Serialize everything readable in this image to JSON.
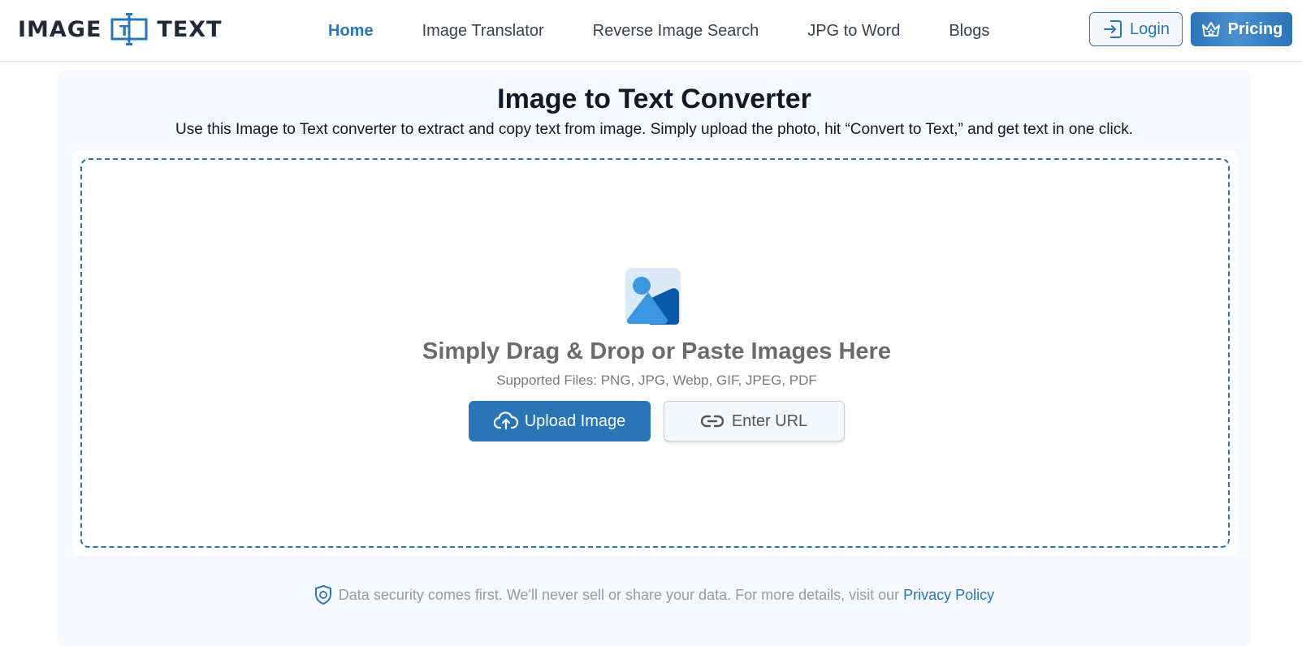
{
  "header": {
    "logo": {
      "left": "IMAGE",
      "mark": "T",
      "right": "TEXT"
    },
    "nav": [
      {
        "label": "Home",
        "active": true
      },
      {
        "label": "Image Translator",
        "active": false
      },
      {
        "label": "Reverse Image Search",
        "active": false
      },
      {
        "label": "JPG to Word",
        "active": false
      },
      {
        "label": "Blogs",
        "active": false
      }
    ],
    "login_label": "Login",
    "pricing_label": "Pricing"
  },
  "main": {
    "title": "Image to Text Converter",
    "subtitle": "Use this Image to Text converter to extract and copy text from image. Simply upload the photo, hit “Convert to Text,” and get text in one click.",
    "drop": {
      "icon": "image-icon",
      "title": "Simply Drag & Drop or Paste Images Here",
      "supported": "Supported Files: PNG, JPG, Webp, GIF, JPEG, PDF",
      "upload_label": "Upload Image",
      "url_label": "Enter URL"
    },
    "security": {
      "text": "Data security comes first. We'll never sell or share your data. For more details, visit our",
      "link": "Privacy Policy"
    }
  },
  "colors": {
    "accent": "#2a74b8",
    "panel_bg": "#f5f8fc",
    "muted_text": "#9a9a9a"
  }
}
